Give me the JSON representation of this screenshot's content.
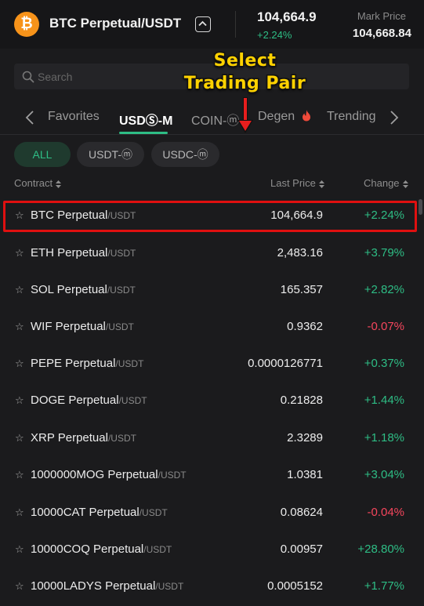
{
  "header": {
    "coin_symbol": "₿",
    "pair_title": "BTC Perpetual/USDT",
    "last_price": "104,664.9",
    "change": "+2.24%",
    "mark_label": "Mark Price",
    "mark_price": "104,668.84"
  },
  "search": {
    "placeholder": "Search"
  },
  "annotation": {
    "line1": "Select",
    "line2": "Trading Pair"
  },
  "tabs": [
    {
      "label": "Favorites"
    },
    {
      "label": "USDⓈ-M",
      "active": true
    },
    {
      "label": "COIN-ⓜ"
    },
    {
      "label": "Degen"
    },
    {
      "label": "Trending"
    }
  ],
  "filters": [
    {
      "label": "ALL",
      "active": true
    },
    {
      "label": "USDT-ⓜ"
    },
    {
      "label": "USDC-ⓜ"
    }
  ],
  "columns": {
    "contract": "Contract",
    "last_price": "Last Price",
    "change": "Change"
  },
  "rows": [
    {
      "symbol": "BTC Perpetual",
      "quote": "/USDT",
      "price": "104,664.9",
      "change": "+2.24%"
    },
    {
      "symbol": "ETH Perpetual",
      "quote": "/USDT",
      "price": "2,483.16",
      "change": "+3.79%"
    },
    {
      "symbol": "SOL Perpetual",
      "quote": "/USDT",
      "price": "165.357",
      "change": "+2.82%"
    },
    {
      "symbol": "WIF Perpetual",
      "quote": "/USDT",
      "price": "0.9362",
      "change": "-0.07%"
    },
    {
      "symbol": "PEPE Perpetual",
      "quote": "/USDT",
      "price": "0.0000126771",
      "change": "+0.37%"
    },
    {
      "symbol": "DOGE Perpetual",
      "quote": "/USDT",
      "price": "0.21828",
      "change": "+1.44%"
    },
    {
      "symbol": "XRP Perpetual",
      "quote": "/USDT",
      "price": "2.3289",
      "change": "+1.18%"
    },
    {
      "symbol": "1000000MOG Perpetual",
      "quote": "/USDT",
      "price": "1.0381",
      "change": "+3.04%"
    },
    {
      "symbol": "10000CAT Perpetual",
      "quote": "/USDT",
      "price": "0.08624",
      "change": "-0.04%"
    },
    {
      "symbol": "10000COQ Perpetual",
      "quote": "/USDT",
      "price": "0.00957",
      "change": "+28.80%"
    },
    {
      "symbol": "10000LADYS Perpetual",
      "quote": "/USDT",
      "price": "0.0005152",
      "change": "+1.77%"
    }
  ],
  "colors": {
    "positive": "#2ebd85",
    "negative": "#f6465d",
    "accent": "#2ebd85",
    "highlight": "#e01010",
    "annotation": "#ffd200"
  },
  "icons": [
    "bitcoin-icon",
    "chevron-up-icon",
    "search-icon",
    "chevron-left-icon",
    "chevron-right-icon",
    "fire-icon",
    "sort-icon",
    "star-icon",
    "arrow-down-icon"
  ]
}
